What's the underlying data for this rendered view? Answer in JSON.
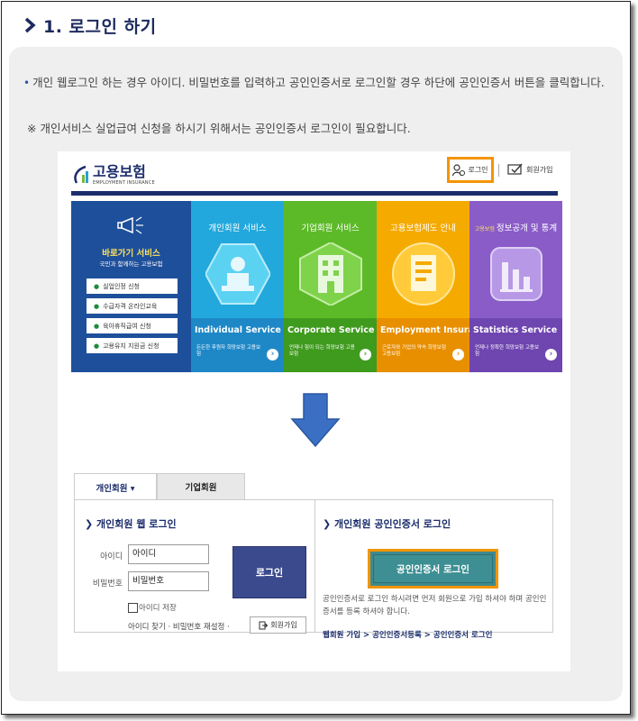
{
  "header": {
    "title": "1. 로그인 하기"
  },
  "instructions": {
    "line1": "개인 웹로그인 하는 경우 아이디. 비밀번호를 입력하고 공인인증서로 로그인할 경우 하단에 공인인증서 버튼을 클릭합니다.",
    "note_mark": "※",
    "line2": "개인서비스 실업급여 신청을 하시기 위해서는 공인인증서 로그인이 필요합니다."
  },
  "site": {
    "logo_kr": "고용보험",
    "logo_en": "EMPLOYMENT INSURANCE",
    "top_login": "로그인",
    "top_join": "회원가입"
  },
  "banner": {
    "shortcut": {
      "title": "바로가기 서비스",
      "subtitle": "국민과 함께하는 고용보험",
      "items": [
        "실업인정 신청",
        "수급자격 온라인교육",
        "육아휴직급여 신청",
        "고용유지 지원금 신청"
      ]
    },
    "cards": [
      {
        "kr": "개인회원 서비스",
        "en": "Individual Service",
        "desc": "든든한 후원자 희망보험 고용보험",
        "color_top": "#22a8dc",
        "color_bottom": "#1e88c7"
      },
      {
        "kr": "기업회원 서비스",
        "en": "Corporate Service",
        "desc": "언제나 힘이 되는 희망보험 고용보험",
        "color_top": "#5cba28",
        "color_bottom": "#3f9b1e"
      },
      {
        "kr": "고용보험제도 안내",
        "en": "Employment Insurance",
        "desc": "근로자와 기업의 약속 희망보험 고용보험",
        "color_top": "#f5aa00",
        "color_bottom": "#e88f00"
      },
      {
        "kr": "정보공개 및 통계",
        "en": "Statistics Service",
        "kr_prefix": "고용보험",
        "desc": "언제나 정확한 희망보험 고용보험",
        "color_top": "#8a5cc8",
        "color_bottom": "#6f45b0"
      }
    ]
  },
  "login": {
    "tabs": {
      "active": "개인회원 ▾",
      "inactive": "기업회원"
    },
    "web_title": "개인회원 웹 로그인",
    "id_label": "아이디",
    "id_value": "아이디",
    "pw_label": "비밀번호",
    "pw_value": "비밀번호",
    "login_button": "로그인",
    "save_id": "아이디 저장",
    "find_links": "아이디 찾기 · 비밀번호 재설정 ·",
    "join_button": "회원가입",
    "cert_title": "개인회원 공인인증서 로그인",
    "cert_button": "공인인증서 로그인",
    "cert_desc": "공인인증서로 로그인 하시려면 먼저 회원으로 가입 하셔야 하며 공인인증서를 등록 하셔야 합니다.",
    "cert_links": "웹회원 가입 > 공인인증서등록 > 공인인증서 로그인"
  },
  "colors": {
    "accent": "#f39400",
    "navy": "#1b2d6b"
  }
}
